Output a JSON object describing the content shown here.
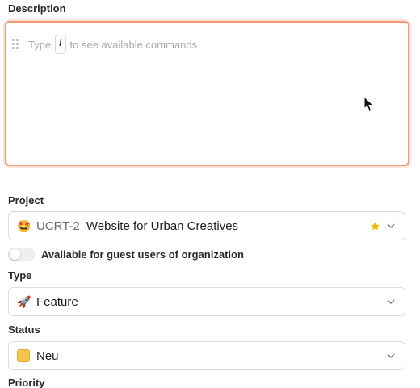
{
  "description": {
    "label": "Description",
    "placeholder_before": "Type",
    "slash_key": "/",
    "placeholder_after": "to see available commands"
  },
  "project": {
    "label": "Project",
    "emoji": "🤩",
    "code": "UCRT-2",
    "name": "Website for Urban Creatives",
    "favorite_icon": "star-icon",
    "favorite_color": "#f5b400"
  },
  "guest_toggle": {
    "label": "Available for guest users of organization",
    "on": false
  },
  "type": {
    "label": "Type",
    "emoji": "🚀",
    "value": "Feature"
  },
  "status": {
    "label": "Status",
    "color": "#f7c34d",
    "value": "Neu"
  },
  "priority": {
    "label": "Priority"
  },
  "colors": {
    "focus_border": "#ef9a77",
    "field_border": "#dcdcdc"
  }
}
